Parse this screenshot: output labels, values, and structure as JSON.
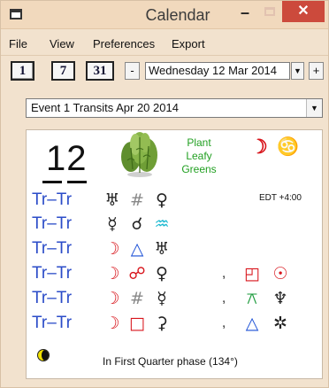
{
  "window": {
    "title": "Calendar",
    "minimize": "–",
    "close": "✕"
  },
  "menu": [
    "File",
    "View",
    "Preferences",
    "Export"
  ],
  "toolbar": {
    "view_buttons": [
      "1",
      "7",
      "31"
    ],
    "prev": "-",
    "next": "+",
    "date": "Wednesday 12 Mar 2014",
    "dropdown_arrow": "▼"
  },
  "event_select": {
    "value": "Event 1 Transits Apr 20 2014",
    "arrow": "▼"
  },
  "day": {
    "number": "12",
    "plant_lines": [
      "Plant",
      "Leafy",
      "Greens"
    ],
    "moon_symbol": "☽",
    "moon_sign_symbol": "♋",
    "timezone": "EDT +4:00"
  },
  "transits": [
    {
      "label": "Tr–Tr",
      "p1": "♅",
      "asp": "#",
      "p2": "♀",
      "c1": "#222222",
      "c2": "#888888",
      "c3": "#222222"
    },
    {
      "label": "Tr–Tr",
      "p1": "☿",
      "asp": "☌",
      "p2": "♒",
      "c1": "#222222",
      "c2": "#222222",
      "c3": "#19b8d0"
    },
    {
      "label": "Tr–Tr",
      "p1": "☽",
      "asp": "△",
      "p2": "♅",
      "c1": "#d8151c",
      "c2": "#1a4fd6",
      "c3": "#222222"
    },
    {
      "label": "Tr–Tr",
      "p1": "☽",
      "asp": "☍",
      "p2": "♀",
      "extra1": "◰",
      "extra2": "☉",
      "c1": "#d8151c",
      "c2": "#d8151c",
      "c3": "#222222",
      "c4": "#d8151c",
      "c5": "#d8151c"
    },
    {
      "label": "Tr–Tr",
      "p1": "☽",
      "asp": "#",
      "p2": "☿",
      "extra1": "⚻",
      "extra2": "♆",
      "c1": "#d8151c",
      "c2": "#888888",
      "c3": "#222222",
      "c4": "#1a9a3a",
      "c5": "#222222"
    },
    {
      "label": "Tr–Tr",
      "p1": "☽",
      "asp": "□",
      "p2": "⚳",
      "extra1": "△",
      "extra2": "✲",
      "c1": "#d8151c",
      "c2": "#d8151c",
      "c3": "#222222",
      "c4": "#1a4fd6",
      "c5": "#222222"
    }
  ],
  "moon_phase": {
    "text": "In First Quarter phase (134°)"
  }
}
